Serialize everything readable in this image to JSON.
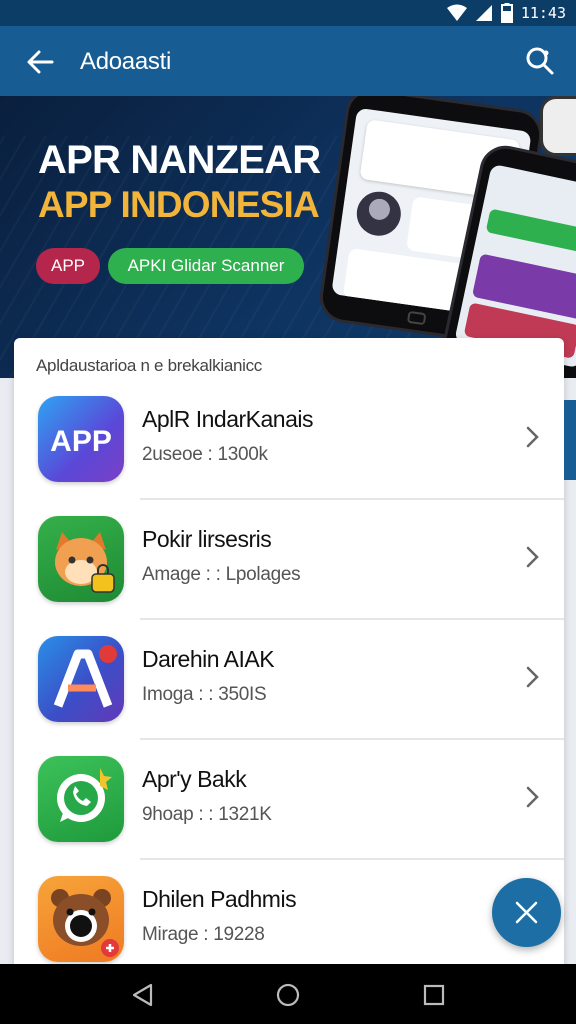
{
  "status_bar": {
    "time": "11:43"
  },
  "app_bar": {
    "title": "Adoaasti"
  },
  "banner": {
    "headline_1": "APR NANZEAR",
    "headline_2": "APP INDONESIA",
    "pill_app": "APP",
    "pill_scan": "APKI Glidar Scanner"
  },
  "list": {
    "subtitle": "Apldaustarioa n e brekalkianicc",
    "items": [
      {
        "name": "AplR IndarKanais",
        "meta": "2useoe : 1300k",
        "icon": "app-logo-icon"
      },
      {
        "name": "Pokir lirsesris",
        "meta": "Amage : : Lpolages",
        "icon": "cartoon-character-icon"
      },
      {
        "name": "Darehin AIAK",
        "meta": "Imoga : : 350IS",
        "icon": "a-logo-icon"
      },
      {
        "name": "Apr'y Bakk",
        "meta": "9hoap : : 1321K",
        "icon": "chat-bubble-icon"
      },
      {
        "name": "Dhilen Padhmis",
        "meta": "Mirage : 19228",
        "icon": "bear-character-icon"
      }
    ]
  },
  "colors": {
    "app_bar": "#175d93",
    "accent": "#1c6ea4",
    "pill_red": "#b5264d",
    "pill_green": "#2fb04e",
    "headline_yellow": "#f2b53a"
  }
}
